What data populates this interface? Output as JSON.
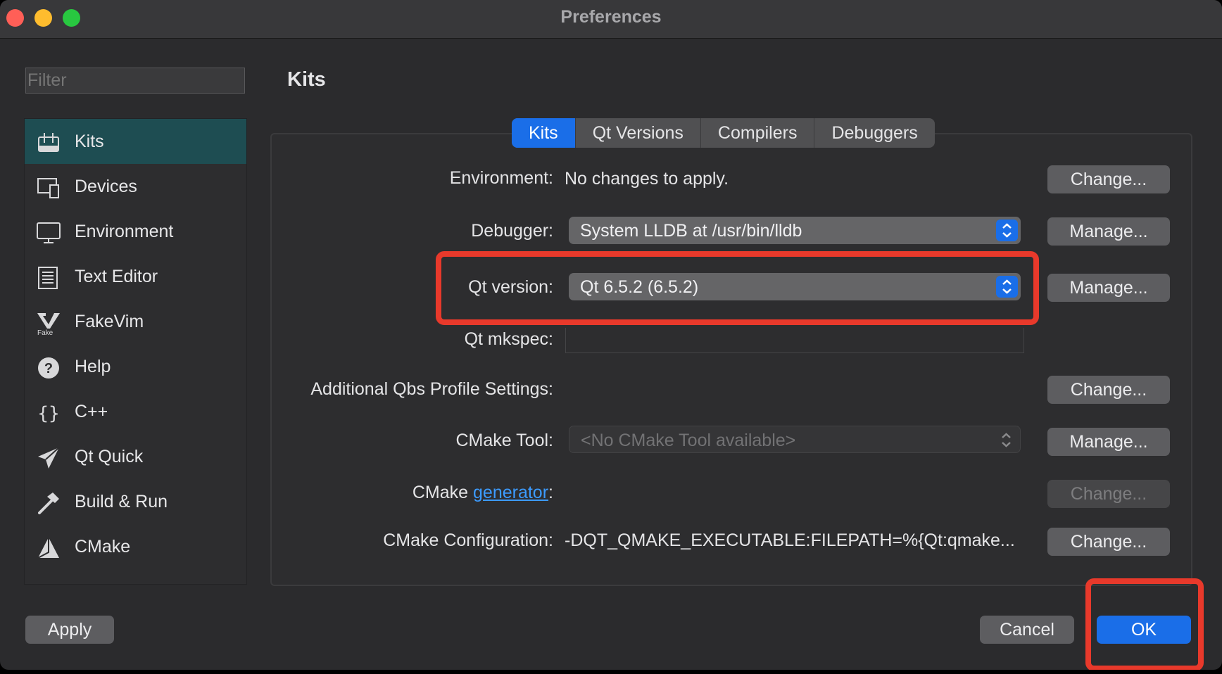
{
  "window": {
    "title": "Preferences"
  },
  "filter": {
    "placeholder": "Filter"
  },
  "sidebar": {
    "items": [
      {
        "label": "Kits",
        "icon": "kits-icon"
      },
      {
        "label": "Devices",
        "icon": "devices-icon"
      },
      {
        "label": "Environment",
        "icon": "monitor-icon"
      },
      {
        "label": "Text Editor",
        "icon": "text-editor-icon"
      },
      {
        "label": "FakeVim",
        "icon": "fakevim-icon"
      },
      {
        "label": "Help",
        "icon": "help-icon"
      },
      {
        "label": "C++",
        "icon": "braces-icon"
      },
      {
        "label": "Qt Quick",
        "icon": "paper-plane-icon"
      },
      {
        "label": "Build & Run",
        "icon": "hammer-icon"
      },
      {
        "label": "CMake",
        "icon": "cmake-icon"
      }
    ],
    "selected": "Kits"
  },
  "page": {
    "heading": "Kits"
  },
  "tabs": [
    "Kits",
    "Qt Versions",
    "Compilers",
    "Debuggers"
  ],
  "form": {
    "environment": {
      "label": "Environment:",
      "value": "No changes to apply.",
      "button": "Change..."
    },
    "debugger": {
      "label": "Debugger:",
      "value": "System LLDB at /usr/bin/lldb",
      "button": "Manage..."
    },
    "qt_version": {
      "label": "Qt version:",
      "value": "Qt 6.5.2 (6.5.2)",
      "button": "Manage..."
    },
    "qt_mkspec": {
      "label": "Qt mkspec:",
      "value": ""
    },
    "qbs": {
      "label": "Additional Qbs Profile Settings:",
      "button": "Change..."
    },
    "cmake_tool": {
      "label": "CMake Tool:",
      "value": "<No CMake Tool available>",
      "button": "Manage..."
    },
    "cmake_generator": {
      "label_prefix": "CMake ",
      "link": "generator",
      "label_suffix": ":",
      "button": "Change..."
    },
    "cmake_config": {
      "label": "CMake Configuration:",
      "value": "-DQT_QMAKE_EXECUTABLE:FILEPATH=%{Qt:qmake...",
      "button": "Change..."
    }
  },
  "footer": {
    "apply": "Apply",
    "cancel": "Cancel",
    "ok": "OK"
  },
  "colors": {
    "accent": "#1a6ee8",
    "highlight": "#e8392b",
    "selected_sidebar": "#1e4d52"
  }
}
